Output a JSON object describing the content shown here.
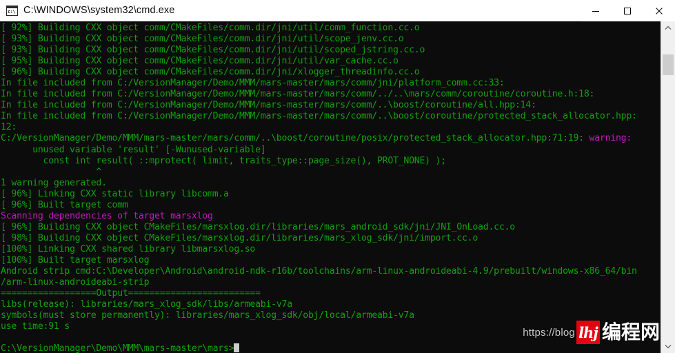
{
  "window": {
    "title": "C:\\WINDOWS\\system32\\cmd.exe",
    "icon": "cmd-console-icon",
    "prompt_glyph": "c:\\",
    "controls": {
      "minimize": "minimize",
      "maximize": "maximize",
      "close": "close"
    }
  },
  "colors": {
    "background": "#0c0c0c",
    "text_green": "#13a10e",
    "text_magenta": "#c019c0",
    "titlebar": "#ffffff",
    "scrollbar_track": "#f0f0f0",
    "scrollbar_thumb": "#cdcdcd",
    "watermark_red": "#e60012"
  },
  "console": {
    "lines": [
      {
        "text": "[ 92%] Building CXX object comm/CMakeFiles/comm.dir/jni/util/comm_function.cc.o",
        "color": "green"
      },
      {
        "text": "[ 93%] Building CXX object comm/CMakeFiles/comm.dir/jni/util/scope_jenv.cc.o",
        "color": "green"
      },
      {
        "text": "[ 93%] Building CXX object comm/CMakeFiles/comm.dir/jni/util/scoped_jstring.cc.o",
        "color": "green"
      },
      {
        "text": "[ 95%] Building CXX object comm/CMakeFiles/comm.dir/jni/util/var_cache.cc.o",
        "color": "green"
      },
      {
        "text": "[ 96%] Building CXX object comm/CMakeFiles/comm.dir/jni/xlogger_threadinfo.cc.o",
        "color": "green"
      },
      {
        "text": "In file included from C:/VersionManager/Demo/MMM/mars-master/mars/comm/jni/platform_comm.cc:33:",
        "color": "green"
      },
      {
        "text": "In file included from C:/VersionManager/Demo/MMM/mars-master/mars/comm/../..\\mars/comm/coroutine/coroutine.h:18:",
        "color": "green"
      },
      {
        "text": "In file included from C:/VersionManager/Demo/MMM/mars-master/mars/comm/..\\boost/coroutine/all.hpp:14:",
        "color": "green"
      },
      {
        "text": "In file included from C:/VersionManager/Demo/MMM/mars-master/mars/comm/..\\boost/coroutine/protected_stack_allocator.hpp:",
        "color": "green"
      },
      {
        "text": "12:",
        "color": "green"
      },
      {
        "text": "C:/VersionManager/Demo/MMM/mars-master/mars/comm/..\\boost/coroutine/posix/protected_stack_allocator.hpp:71:19: ",
        "color": "green",
        "suffix": "warning:",
        "suffix_color": "magenta"
      },
      {
        "text": "      unused variable 'result' [-Wunused-variable]",
        "color": "green"
      },
      {
        "text": "        const int result( ::mprotect( limit, traits_type::page_size(), PROT_NONE) );",
        "color": "green"
      },
      {
        "text": "                  ^",
        "color": "green"
      },
      {
        "text": "1 warning generated.",
        "color": "green"
      },
      {
        "text": "[ 96%] Linking CXX static library libcomm.a",
        "color": "green"
      },
      {
        "text": "[ 96%] Built target comm",
        "color": "green"
      },
      {
        "text": "Scanning dependencies of target marsxlog",
        "color": "magenta"
      },
      {
        "text": "[ 96%] Building CXX object CMakeFiles/marsxlog.dir/libraries/mars_android_sdk/jni/JNI_OnLoad.cc.o",
        "color": "green"
      },
      {
        "text": "[ 98%] Building CXX object CMakeFiles/marsxlog.dir/libraries/mars_xlog_sdk/jni/import.cc.o",
        "color": "green"
      },
      {
        "text": "[100%] Linking CXX shared library libmarsxlog.so",
        "color": "green"
      },
      {
        "text": "[100%] Built target marsxlog",
        "color": "green"
      },
      {
        "text": "Android strip cmd:C:\\Developer\\Android\\android-ndk-r16b/toolchains/arm-linux-androideabi-4.9/prebuilt/windows-x86_64/bin",
        "color": "green"
      },
      {
        "text": "/arm-linux-androideabi-strip",
        "color": "green"
      },
      {
        "text": "==================Output=========================",
        "color": "green"
      },
      {
        "text": "libs(release): libraries/mars_xlog_sdk/libs/armeabi-v7a",
        "color": "green"
      },
      {
        "text": "symbols(must store permanently): libraries/mars_xlog_sdk/obj/local/armeabi-v7a",
        "color": "green"
      },
      {
        "text": "use time:91 s",
        "color": "green"
      },
      {
        "text": "",
        "color": "green"
      },
      {
        "text": "C:\\VersionManager\\Demo\\MMM\\mars-master\\mars>",
        "color": "green",
        "cursor": true
      }
    ]
  },
  "scrollbar": {
    "up_arrow": "chevron-up-icon",
    "down_arrow": "chevron-down-icon",
    "thumb_position_percent": 10
  },
  "watermark": {
    "url": "https://blog",
    "logo_text": "lhj",
    "site_name": "编程网"
  }
}
